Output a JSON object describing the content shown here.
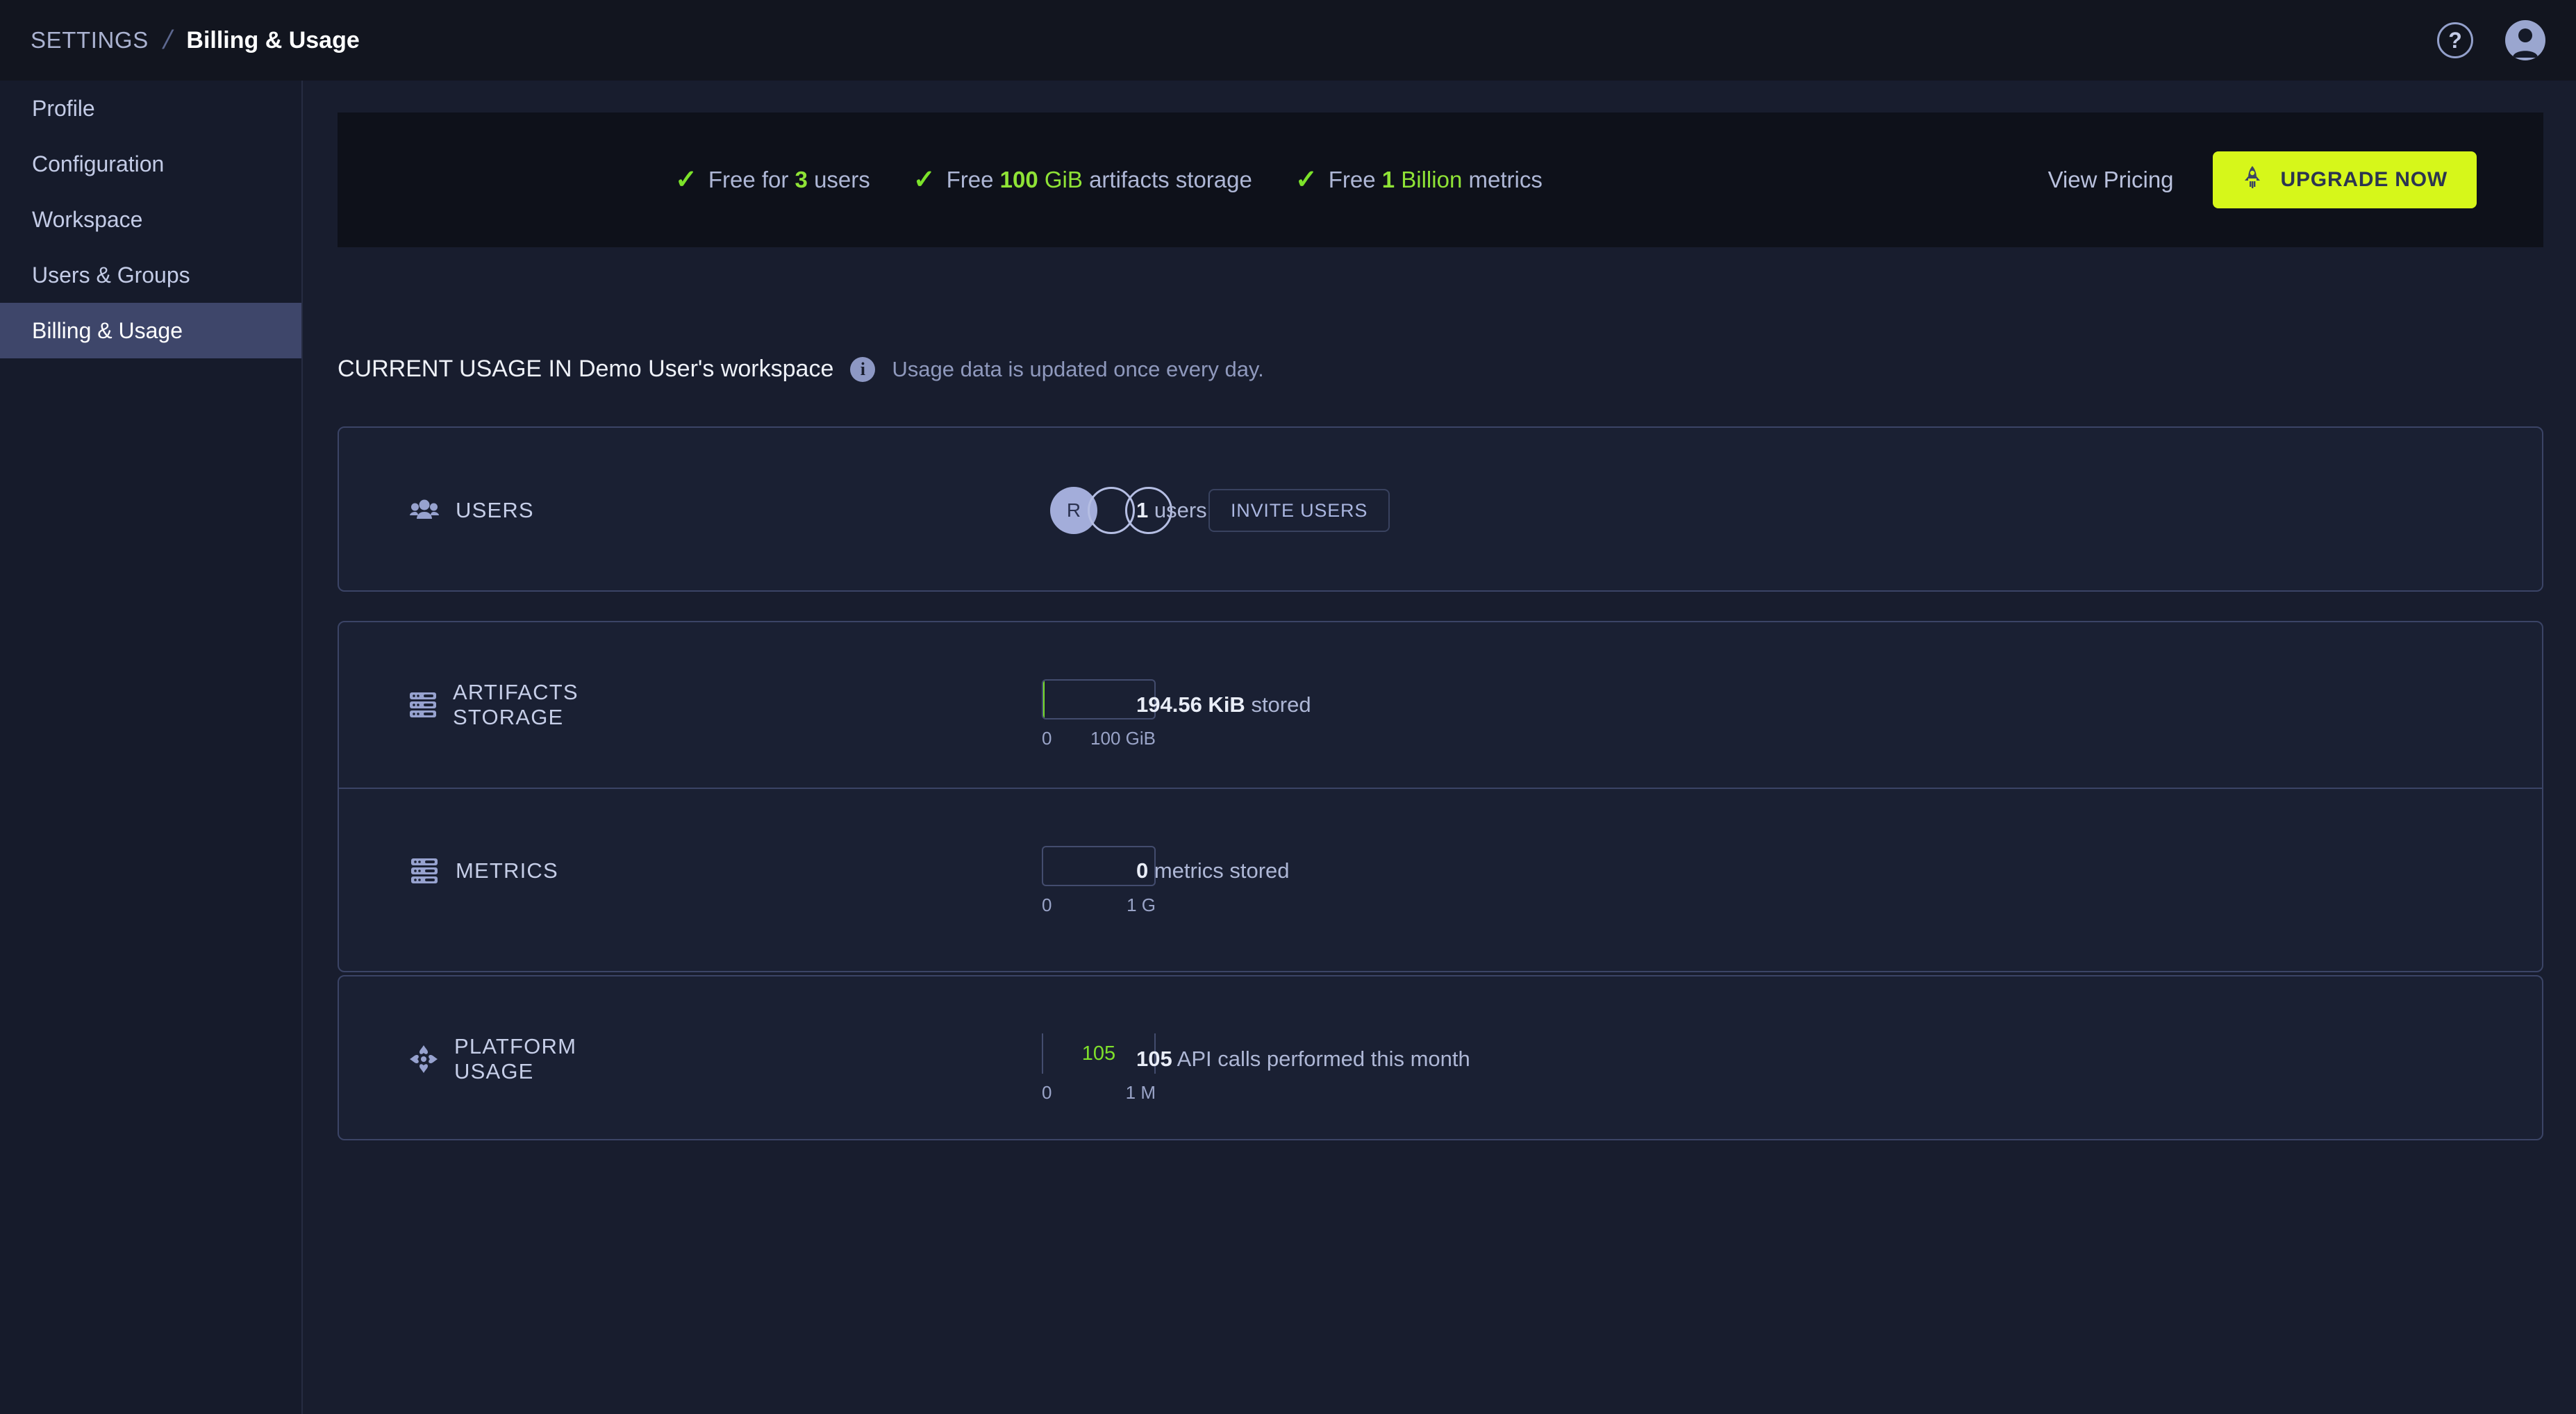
{
  "topbar": {
    "breadcrumb_root": "SETTINGS",
    "breadcrumb_sep": "/",
    "breadcrumb_current": "Billing & Usage",
    "help_glyph": "?",
    "help_icon_name": "help-circle-icon",
    "avatar_icon_name": "user-avatar-icon"
  },
  "sidebar": {
    "items": [
      {
        "label": "Profile",
        "active": false
      },
      {
        "label": "Configuration",
        "active": false
      },
      {
        "label": "Workspace",
        "active": false
      },
      {
        "label": "Users & Groups",
        "active": false
      },
      {
        "label": "Billing & Usage",
        "active": true
      }
    ]
  },
  "banner": {
    "check_glyph": "✓",
    "features": [
      {
        "pre": "Free for ",
        "value": "3",
        "post": " users",
        "unit": ""
      },
      {
        "pre": "Free ",
        "value": "100",
        "unit": " GiB",
        "post": " artifacts storage"
      },
      {
        "pre": "Free ",
        "value": "1",
        "unit": " Billion",
        "post": " metrics"
      }
    ],
    "view_pricing": "View Pricing",
    "upgrade_label": "UPGRADE NOW",
    "upgrade_icon": "rocket-icon",
    "upgrade_bg": "#d6f71a",
    "accent_green": "#8fe336"
  },
  "section": {
    "title": "CURRENT USAGE IN Demo User's workspace",
    "info_glyph": "i",
    "note": "Usage data is updated once every day."
  },
  "usage": {
    "users": {
      "label": "USERS",
      "icon": "users-group-icon",
      "avatars": [
        {
          "initial": "R",
          "filled": true
        },
        {
          "initial": "",
          "filled": false
        },
        {
          "initial": "",
          "filled": false
        }
      ],
      "count": "1",
      "count_suffix": " users",
      "invite_label": "INVITE USERS"
    },
    "artifacts_storage": {
      "label": "ARTIFACTS STORAGE",
      "icon": "server-rack-icon",
      "min_tick": "0",
      "max_tick": "100 GiB",
      "fill_percent": 1,
      "fill_color": "#79e02b",
      "value": "194.56 KiB",
      "value_suffix": " stored"
    },
    "metrics": {
      "label": "METRICS",
      "icon": "server-rack-icon",
      "min_tick": "0",
      "max_tick": "1 G",
      "fill_percent": 0,
      "fill_color": "#79e02b",
      "value": "0",
      "value_suffix": " metrics stored"
    },
    "platform_usage": {
      "label": "PLATFORM USAGE",
      "icon": "platform-diamond-icon",
      "min_tick": "0",
      "max_tick": "1 M",
      "gauge_value": "105",
      "gauge_value_color": "#7fe02b",
      "value": "105",
      "value_suffix": " API calls performed this month"
    }
  }
}
